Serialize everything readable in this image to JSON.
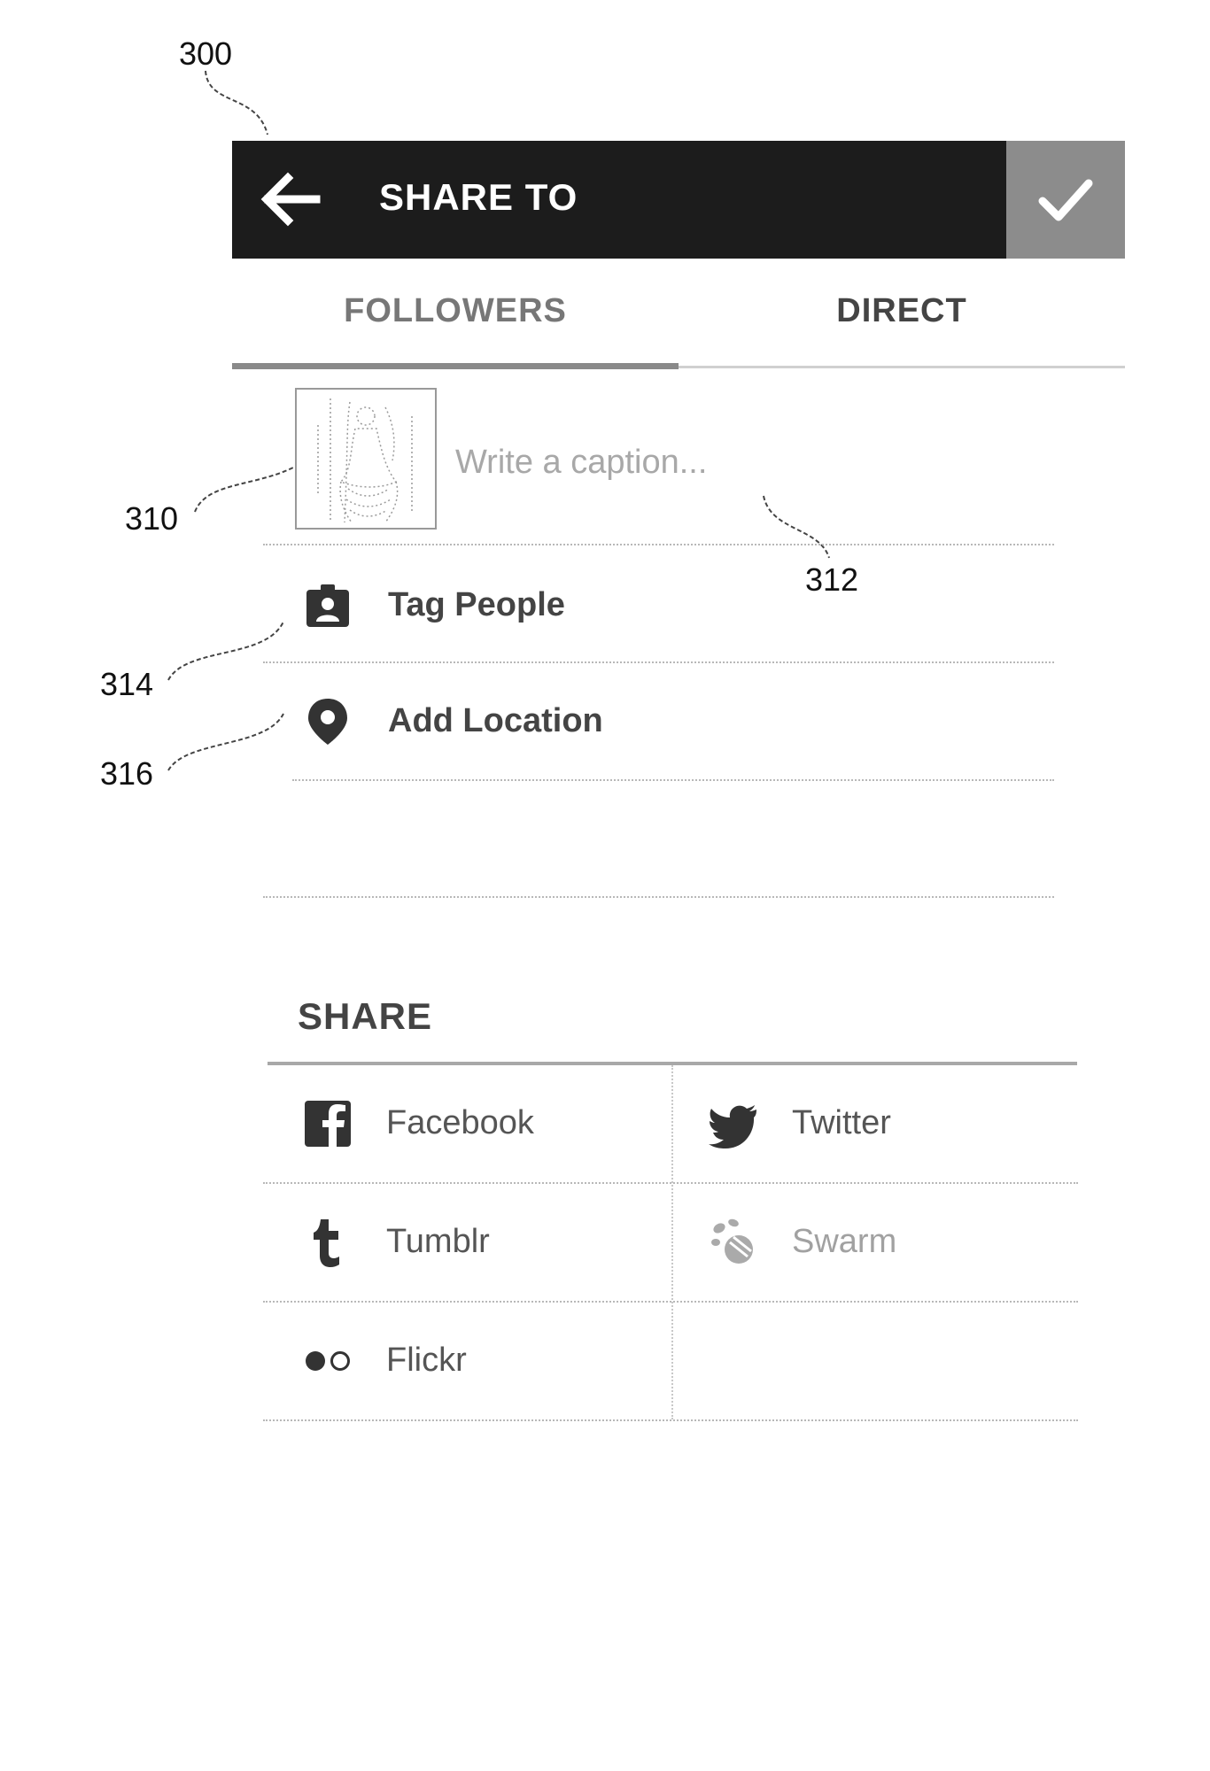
{
  "figure": {
    "ref_300": "300",
    "ref_310": "310",
    "ref_312": "312",
    "ref_314": "314",
    "ref_316": "316"
  },
  "topbar": {
    "title": "SHARE TO",
    "back_icon": "arrow-left-icon",
    "confirm_icon": "checkmark-icon"
  },
  "tabs": [
    {
      "label": "FOLLOWERS",
      "selected": true
    },
    {
      "label": "DIRECT",
      "selected": false
    }
  ],
  "caption": {
    "placeholder": "Write a caption..."
  },
  "options": [
    {
      "label": "Tag People",
      "icon": "tag-person-icon"
    },
    {
      "label": "Add Location",
      "icon": "location-pin-icon"
    }
  ],
  "share": {
    "heading": "SHARE",
    "services": [
      {
        "label": "Facebook",
        "icon": "facebook-icon",
        "enabled": true
      },
      {
        "label": "Twitter",
        "icon": "twitter-icon",
        "enabled": true
      },
      {
        "label": "Tumblr",
        "icon": "tumblr-icon",
        "enabled": true
      },
      {
        "label": "Swarm",
        "icon": "swarm-icon",
        "enabled": false
      },
      {
        "label": "Flickr",
        "icon": "flickr-icon",
        "enabled": true
      }
    ]
  },
  "colors": {
    "topbar_bg": "#1c1c1c",
    "confirm_bg": "#8c8c8c",
    "text_dark": "#444444",
    "text_muted": "#a8a8a8"
  }
}
